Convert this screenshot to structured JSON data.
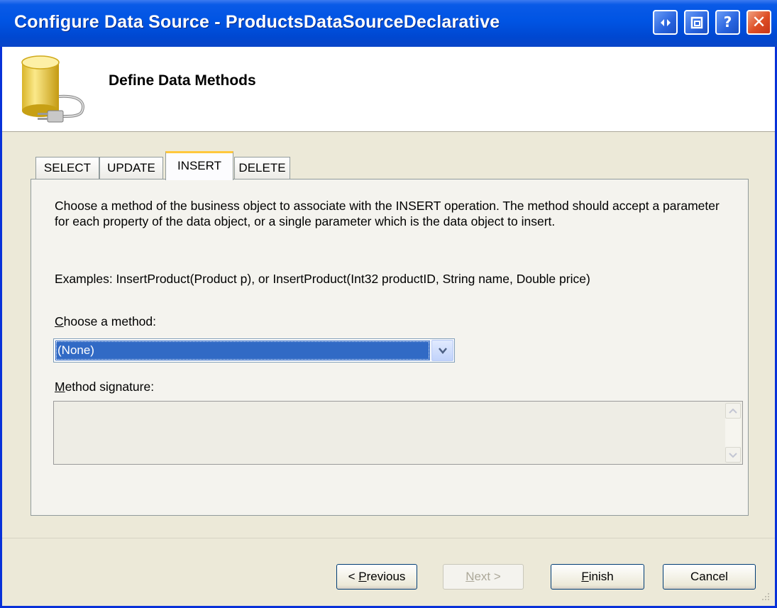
{
  "window": {
    "title": "Configure Data Source - ProductsDataSourceDeclarative"
  },
  "header": {
    "title": "Define Data Methods"
  },
  "tabs": [
    {
      "label": "SELECT"
    },
    {
      "label": "UPDATE"
    },
    {
      "label": "INSERT"
    },
    {
      "label": "DELETE"
    }
  ],
  "active_tab": "INSERT",
  "panel": {
    "description": "Choose a method of the business object to associate with the INSERT operation. The method should accept a parameter for each property of the data object, or a single parameter which is the data object to insert.",
    "examples": "Examples: InsertProduct(Product p), or InsertProduct(Int32 productID, String name, Double price)",
    "choose_method": {
      "mnemonic": "C",
      "rest": "hoose a method:"
    },
    "method_value": "(None)",
    "signature_label": {
      "mnemonic": "M",
      "rest": "ethod signature:"
    },
    "signature_value": ""
  },
  "buttons": {
    "previous": {
      "pre": "< ",
      "mnemonic": "P",
      "rest": "revious"
    },
    "next": {
      "mnemonic": "N",
      "rest": "ext >"
    },
    "finish": {
      "mnemonic": "F",
      "rest": "inish"
    },
    "cancel": "Cancel"
  },
  "icons": {
    "title_buttons": [
      "expand-icon",
      "restore-icon",
      "help-icon",
      "close-icon"
    ],
    "header": "database-plug-icon"
  },
  "colors": {
    "titlebar": "#0054e3",
    "selection": "#316ac5",
    "active_tab_accent": "#ffc83c",
    "dialog_bg": "#ece9d8"
  }
}
